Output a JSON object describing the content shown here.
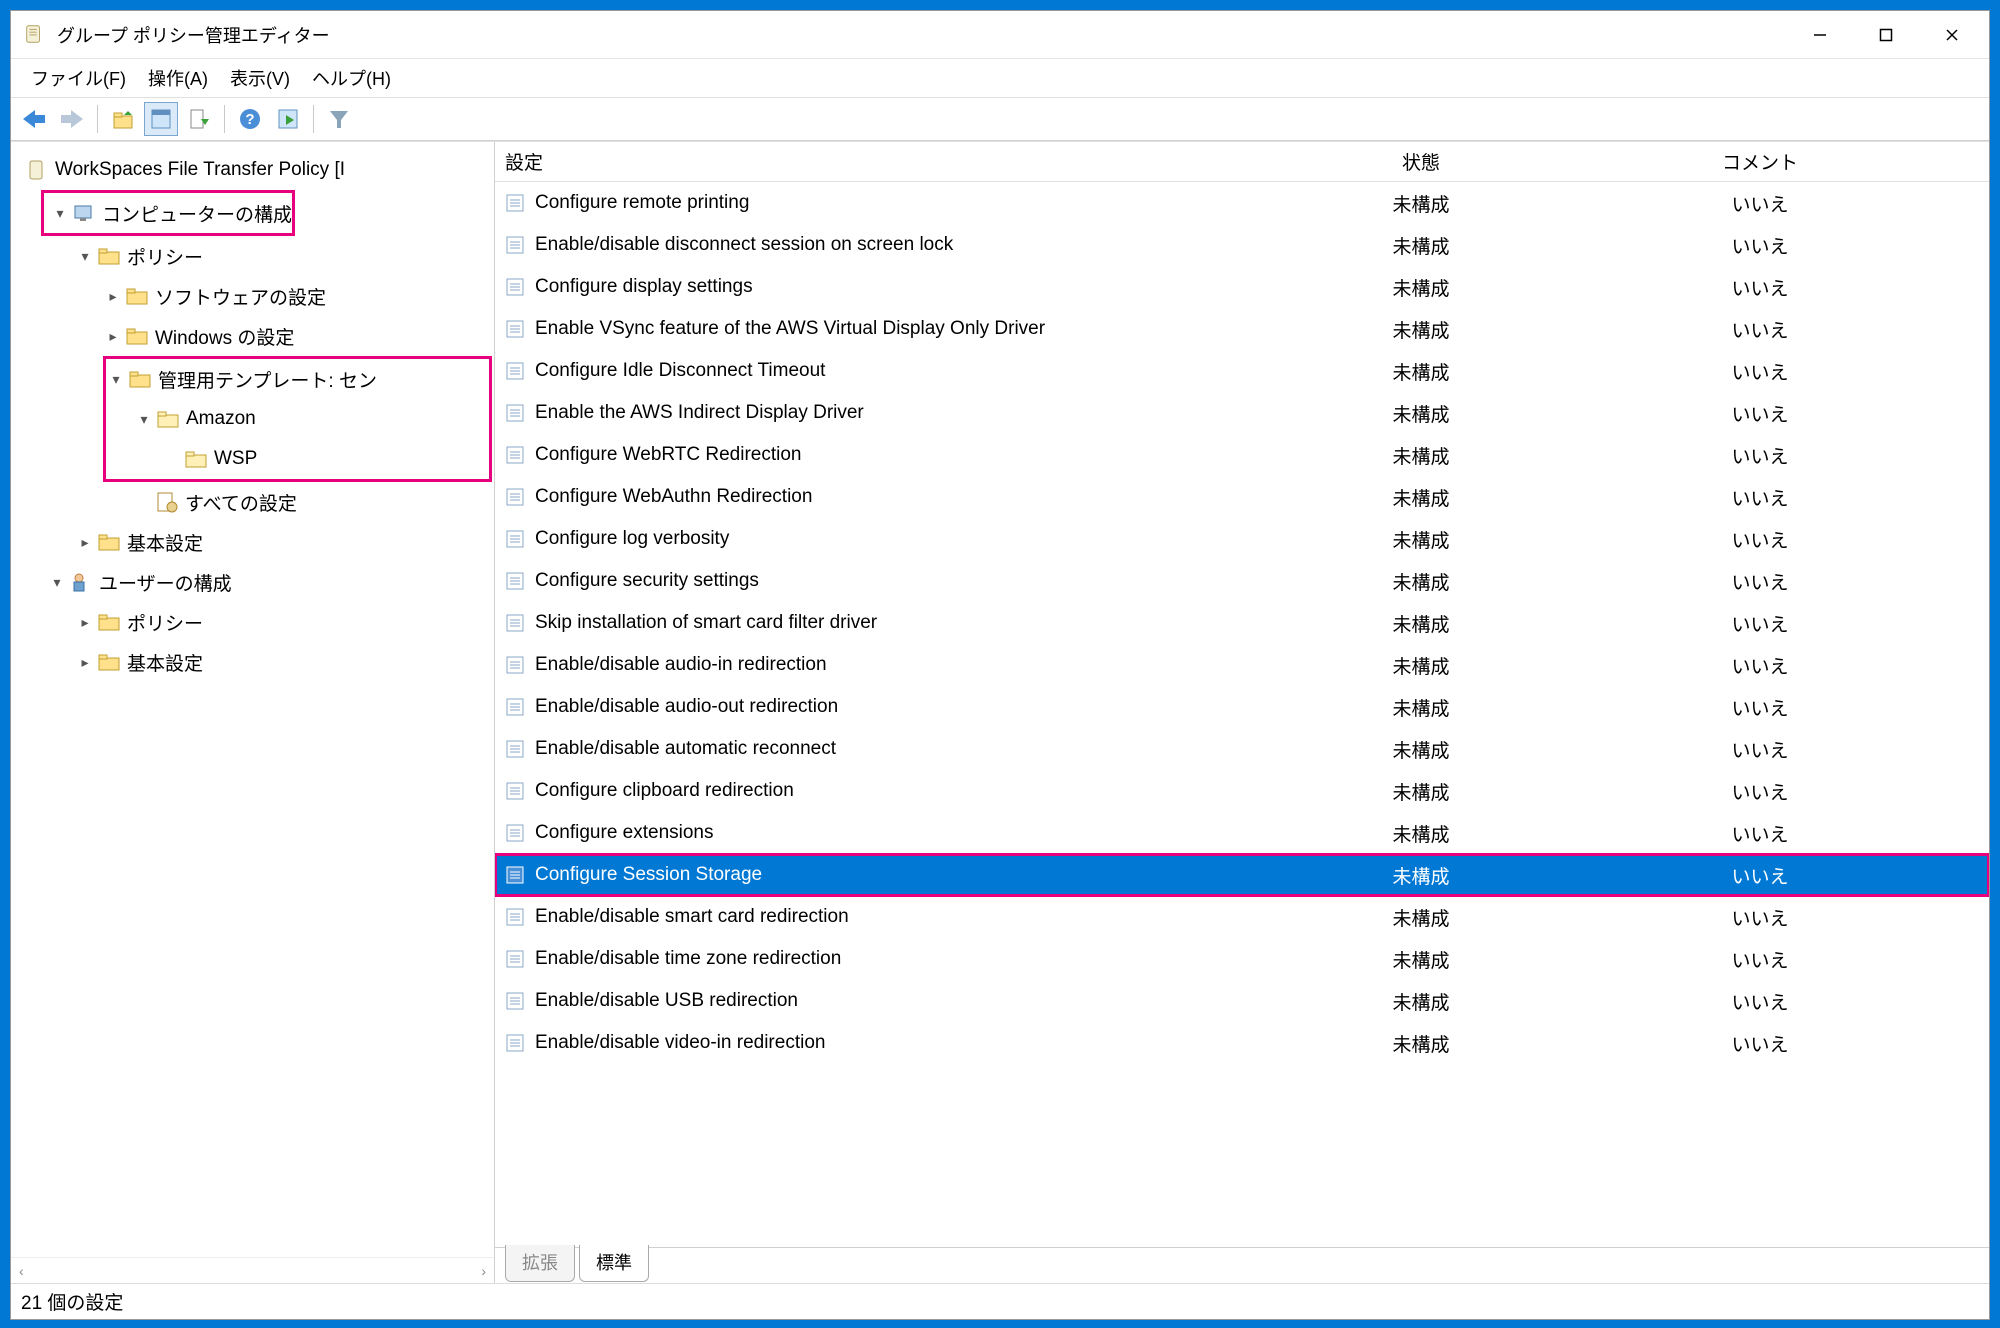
{
  "window": {
    "title": "グループ ポリシー管理エディター"
  },
  "menus": {
    "file": "ファイル(F)",
    "action": "操作(A)",
    "view": "表示(V)",
    "help": "ヘルプ(H)"
  },
  "tree": {
    "root": "WorkSpaces File Transfer Policy [I",
    "computer_config": "コンピューターの構成",
    "policies": "ポリシー",
    "software_settings": "ソフトウェアの設定",
    "windows_settings": "Windows の設定",
    "admin_templates": "管理用テンプレート: セン",
    "amazon": "Amazon",
    "wsp": "WSP",
    "all_settings": "すべての設定",
    "preferences": "基本設定",
    "user_config": "ユーザーの構成",
    "user_policies": "ポリシー",
    "user_preferences": "基本設定"
  },
  "columns": {
    "setting": "設定",
    "state": "状態",
    "comment": "コメント"
  },
  "state_text": "未構成",
  "comment_text": "いいえ",
  "settings": [
    "Configure remote printing",
    "Enable/disable disconnect session on screen lock",
    "Configure display settings",
    "Enable VSync feature of the AWS Virtual Display Only Driver",
    "Configure Idle Disconnect Timeout",
    "Enable the AWS Indirect Display Driver",
    "Configure WebRTC Redirection",
    "Configure WebAuthn Redirection",
    "Configure log verbosity",
    "Configure security settings",
    "Skip installation of smart card filter driver",
    "Enable/disable audio-in redirection",
    "Enable/disable audio-out redirection",
    "Enable/disable automatic reconnect",
    "Configure clipboard redirection",
    "Configure extensions",
    "Configure Session Storage",
    "Enable/disable smart card redirection",
    "Enable/disable time zone redirection",
    "Enable/disable USB redirection",
    "Enable/disable video-in redirection"
  ],
  "selected_index": 16,
  "tabs": {
    "extended": "拡張",
    "standard": "標準"
  },
  "statusbar": "21 個の設定"
}
